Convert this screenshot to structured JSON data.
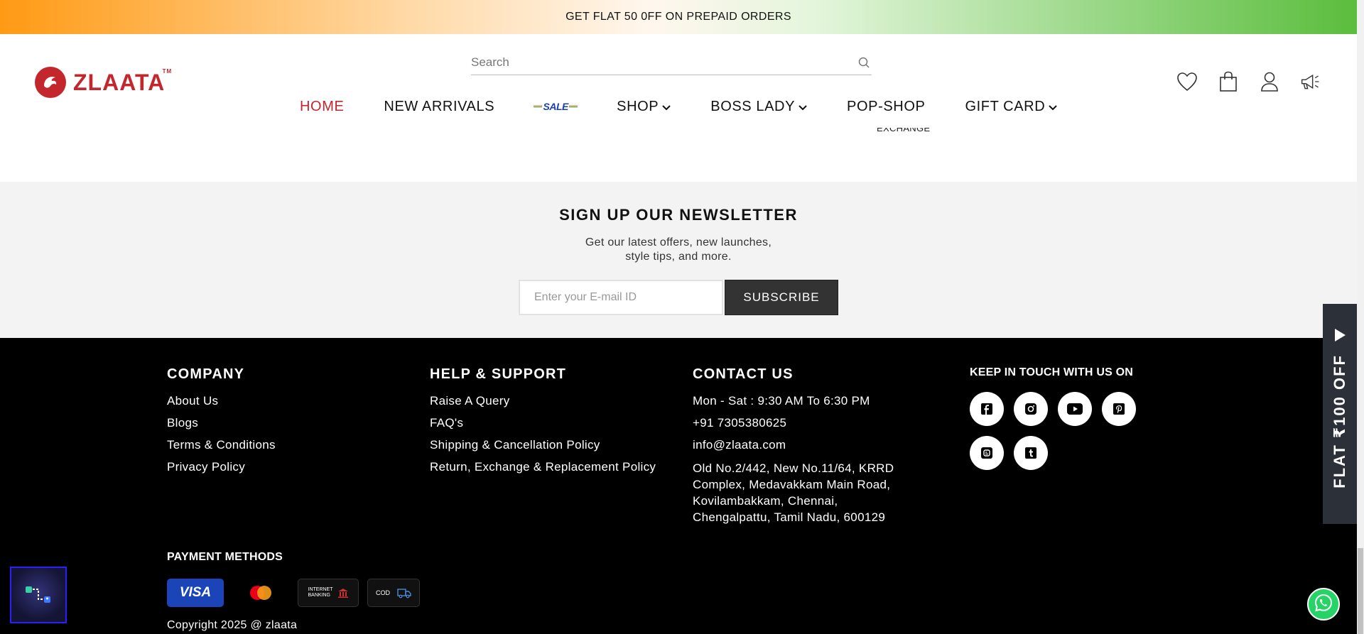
{
  "announcement": "GET FLAT 50 0FF ON PREPAID ORDERS",
  "brand": {
    "name": "ZLAATA",
    "tm": "TM",
    "color": "#c4262e"
  },
  "search": {
    "placeholder": "Search"
  },
  "nav": {
    "items": [
      {
        "label": "HOME",
        "active": true
      },
      {
        "label": "NEW ARRIVALS"
      },
      {
        "label": "SALE",
        "badge": true
      },
      {
        "label": "SHOP",
        "dropdown": true
      },
      {
        "label": "BOSS LADY",
        "dropdown": true
      },
      {
        "label": "POP-SHOP"
      },
      {
        "label": "GIFT CARD",
        "dropdown": true
      }
    ]
  },
  "header_icons": [
    "heart-icon",
    "shopping-bag-icon",
    "user-icon",
    "megaphone-icon"
  ],
  "partial_text": "EXCHANGE",
  "newsletter": {
    "title": "SIGN UP OUR NEWSLETTER",
    "subtitle_line1": "Get our latest offers, new launches,",
    "subtitle_line2": "style tips, and more.",
    "input_placeholder": "Enter your E-mail ID",
    "button": "SUBSCRIBE"
  },
  "footer": {
    "company": {
      "title": "COMPANY",
      "links": [
        "About Us",
        "Blogs",
        "Terms & Conditions",
        "Privacy Policy"
      ]
    },
    "help": {
      "title": "HELP & SUPPORT",
      "links": [
        "Raise A Query",
        "FAQ's",
        "Shipping & Cancellation Policy",
        "Return, Exchange & Replacement Policy"
      ]
    },
    "contact": {
      "title": "CONTACT US",
      "hours": "Mon - Sat : 9:30 AM To 6:30 PM",
      "phone": "+91 7305380625",
      "email": "info@zlaata.com",
      "address": "Old No.2/442, New No.11/64, KRRD Complex, Medavakkam Main Road, Kovilambakkam, Chennai, Chengalpattu, Tamil Nadu, 600129"
    },
    "keep_in_touch": {
      "title": "KEEP IN TOUCH WITH US ON",
      "socials": [
        "facebook-icon",
        "instagram-icon",
        "youtube-icon",
        "pinterest-icon",
        "blogger-icon",
        "tumblr-icon"
      ]
    },
    "payment": {
      "title": "PAYMENT METHODS",
      "visa": "VISA",
      "netbanking_line1": "INTERNET",
      "netbanking_line2": "BANKING",
      "cod": "COD"
    },
    "copyright": "Copyright 2025 @ zlaata"
  },
  "side_tab": {
    "label": "FLAT ₹100 OFF"
  },
  "colors": {
    "accent": "#c4262e",
    "footer_bg": "#000000",
    "newsletter_bg": "#f3f3f3",
    "button_bg": "#333333",
    "whatsapp": "#25d366"
  }
}
